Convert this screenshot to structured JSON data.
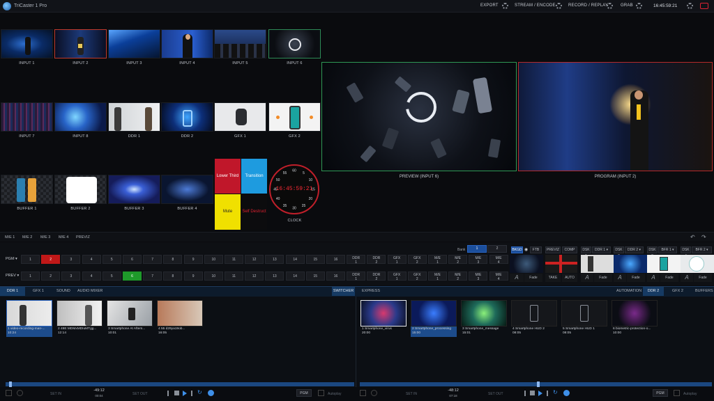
{
  "app": {
    "title": "TriCaster 1 Pro"
  },
  "topbar": {
    "items": [
      "EXPORT",
      "STREAM / ENCODE",
      "RECORD / REPLAY",
      "GRAB"
    ],
    "clock": "16:45:59:21"
  },
  "inputs": {
    "row1": [
      "INPUT 1",
      "INPUT 2",
      "INPUT 3",
      "INPUT 4",
      "INPUT 5",
      "INPUT 6"
    ],
    "row2": [
      "INPUT 7",
      "INPUT 8",
      "DDR 1",
      "DDR 2",
      "GFX 1",
      "GFX 2"
    ],
    "row3": [
      "BUFFER 1",
      "BUFFER 2",
      "BUFFER 3",
      "BUFFER 4"
    ]
  },
  "macros": {
    "lower_third": "Lower Third",
    "transition": "Transition",
    "mute": "Mute",
    "self_destruct": "Self Destruct"
  },
  "clock_widget": {
    "time": "16:45:59:21",
    "label": "CLOCK",
    "dial": [
      "60",
      "5",
      "10",
      "15",
      "20",
      "25",
      "30",
      "35",
      "40",
      "45",
      "50",
      "55"
    ]
  },
  "monitors": {
    "preview": "PREVIEW (INPUT 6)",
    "program": "PROGRAM (INPUT 2)"
  },
  "me_tabs": [
    "M/E 1",
    "M/E 2",
    "M/E 3",
    "M/E 4",
    "PREVIZ"
  ],
  "switcher": {
    "bank_label": "Bank",
    "banks": [
      "1",
      "2"
    ],
    "pgm_label": "PGM ▾",
    "prev_label": "PREV ▾",
    "buttons": [
      "1",
      "2",
      "3",
      "4",
      "5",
      "6",
      "7",
      "8",
      "9",
      "10",
      "11",
      "12",
      "13",
      "14",
      "15",
      "16"
    ],
    "extra": [
      "DDR 1",
      "DDR 2",
      "GFX 1",
      "GFX 2",
      "M/E 1",
      "M/E 2",
      "M/E 3",
      "M/E 4"
    ],
    "pgm_active": "2",
    "prev_active": "6",
    "right_buttons": [
      "BKGD",
      "FTB",
      "PREVIZ",
      "COMP"
    ],
    "dsk": [
      "DSK 1",
      "DDR 1 ▾",
      "DSK 2",
      "DDR 2 ▾",
      "DSK 3",
      "BFR 1 ▾",
      "DSK 4",
      "BFR 2 ▾"
    ],
    "fade": "Fade",
    "take": "TAKE",
    "auto": "AUTO"
  },
  "bottom_tabs": {
    "left": [
      "DDR 1",
      "GFX 1",
      "SOUND",
      "AUDIO MIXER"
    ],
    "mid": [
      "SWITCHER",
      "EXPRESS"
    ],
    "right": [
      "AUTOMATION",
      "DDR 2",
      "GFX 2",
      "BUFFERS"
    ]
  },
  "ddr1_clips": [
    {
      "name": "1 video-recording-man-...",
      "dur": "10:24"
    },
    {
      "name": "2 49E MDMxMDIuMTgg...",
      "dur": "12:14"
    },
    {
      "name": "3 Smartphone At Afters...",
      "dur": "10:01"
    },
    {
      "name": "4 55 d29ya19ob...",
      "dur": "16:05"
    }
  ],
  "ddr2_clips": [
    {
      "name": "1 Smartphone_virus",
      "dur": "20:00"
    },
    {
      "name": "2 Smartphone_processing",
      "dur": "15:00"
    },
    {
      "name": "3 Smartphone_message",
      "dur": "15:01"
    },
    {
      "name": "4 Smartphone HUD 2",
      "dur": "08:05"
    },
    {
      "name": "5 Smartphone HUD 1",
      "dur": "08:05"
    },
    {
      "name": "6 biometric-protection-o...",
      "dur": "10:00"
    }
  ],
  "transport": {
    "left": {
      "time": "-49:12",
      "sub": "00:04",
      "in": "SET IN",
      "out": "SET OUT",
      "pgm": "PGM",
      "autoplay": "Autoplay"
    },
    "right": {
      "time": "-48:12",
      "sub": "07:18",
      "in": "SET IN",
      "out": "SET OUT",
      "pgm": "PGM",
      "autoplay": "Autoplay"
    }
  }
}
